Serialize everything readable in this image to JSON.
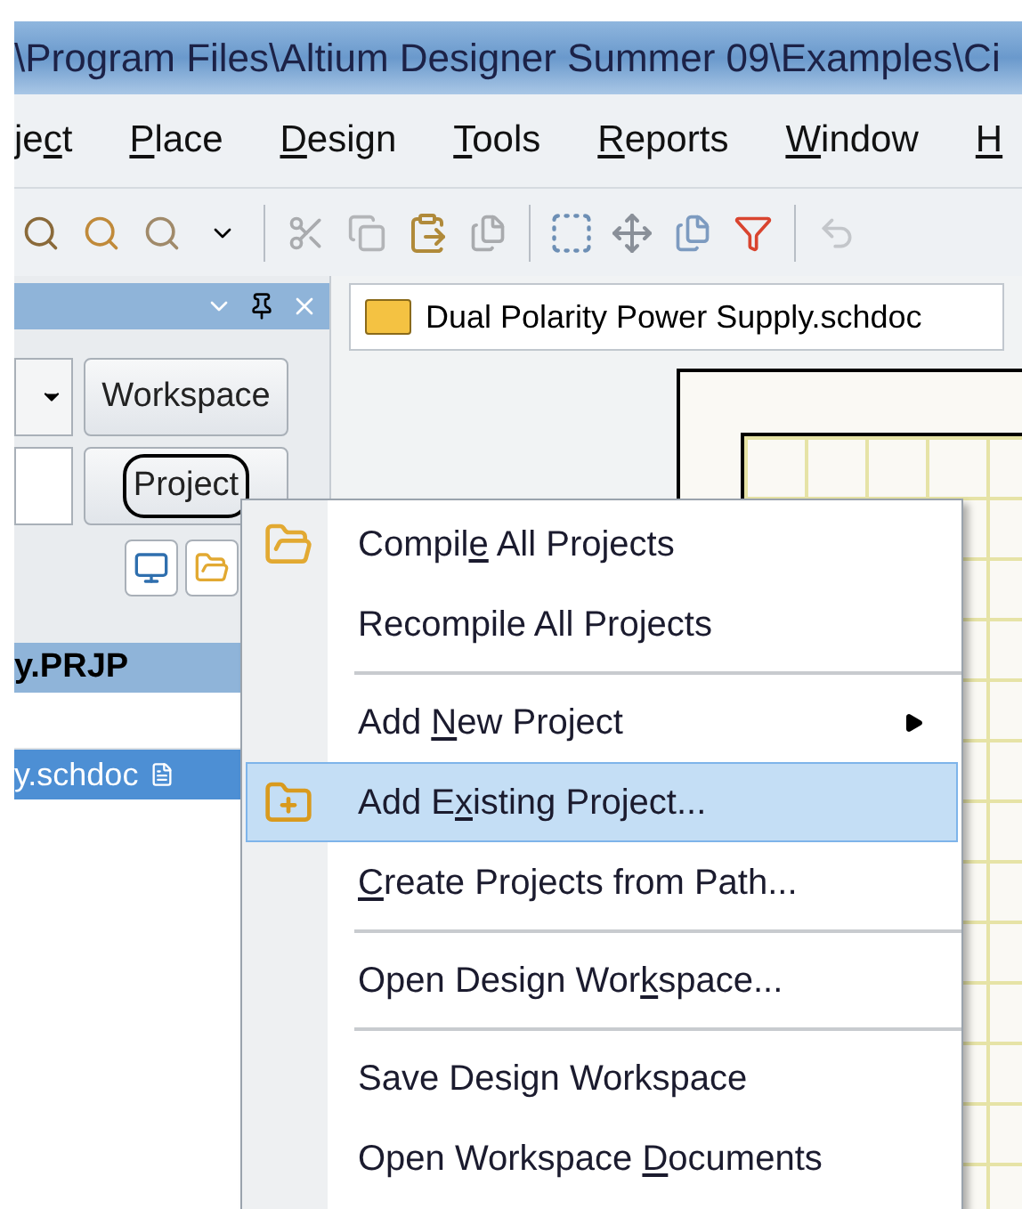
{
  "window": {
    "title": "\\Program Files\\Altium Designer Summer 09\\Examples\\Ci"
  },
  "menu_bar": [
    {
      "pre": "je",
      "key": "c",
      "post": "t"
    },
    {
      "key": "P",
      "post": "lace"
    },
    {
      "key": "D",
      "post": "esign"
    },
    {
      "key": "T",
      "post": "ools"
    },
    {
      "key": "R",
      "post": "eports"
    },
    {
      "key": "W",
      "post": "indow"
    },
    {
      "key": "H"
    }
  ],
  "panel": {
    "workspace_button": "Workspace",
    "project_button": {
      "label": "Project",
      "circled": true
    },
    "project_header": "y.PRJP",
    "documents": [
      {
        "name": "y.schdoc",
        "selected": true
      }
    ]
  },
  "document_tab": {
    "title": "Dual Polarity Power Supply.schdoc",
    "selected": true
  },
  "context_menu": [
    {
      "kind": "compile",
      "pre": "Compil",
      "key": "e",
      "post": " All Projects",
      "selected": false
    },
    {
      "kind": "command",
      "post": "Recompile All Projects",
      "selected": false
    },
    {
      "kind": "separator"
    },
    {
      "kind": "submenu",
      "pre": "Add ",
      "key": "N",
      "post": "ew Project",
      "selected": false
    },
    {
      "kind": "add",
      "pre": "Add E",
      "key": "x",
      "post": "isting Project...",
      "selected": true
    },
    {
      "kind": "command",
      "key": "C",
      "post": "reate Projects from Path...",
      "selected": false
    },
    {
      "kind": "separator"
    },
    {
      "kind": "command",
      "pre": "Open Design Wor",
      "key": "k",
      "post": "space...",
      "selected": false
    },
    {
      "kind": "separator"
    },
    {
      "kind": "command",
      "post": "Save Design Workspace",
      "selected": false
    },
    {
      "kind": "command",
      "pre": "Open Workspace ",
      "key": "D",
      "post": "ocuments",
      "selected": false
    }
  ]
}
